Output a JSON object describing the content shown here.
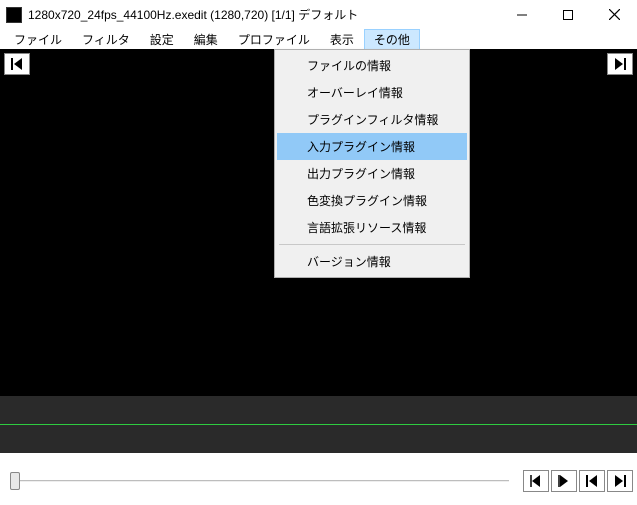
{
  "window": {
    "title": "1280x720_24fps_44100Hz.exedit (1280,720) [1/1] デフォルト"
  },
  "menubar": {
    "items": [
      {
        "label": "ファイル"
      },
      {
        "label": "フィルタ"
      },
      {
        "label": "設定"
      },
      {
        "label": "編集"
      },
      {
        "label": "プロファイル"
      },
      {
        "label": "表示"
      },
      {
        "label": "その他",
        "open": true
      }
    ]
  },
  "dropdown": {
    "items": [
      {
        "label": "ファイルの情報"
      },
      {
        "label": "オーバーレイ情報"
      },
      {
        "label": "プラグインフィルタ情報"
      },
      {
        "label": "入力プラグイン情報",
        "highlight": true
      },
      {
        "label": "出力プラグイン情報"
      },
      {
        "label": "色変換プラグイン情報"
      },
      {
        "label": "言語拡張リソース情報"
      }
    ],
    "footer": "バージョン情報"
  },
  "colors": {
    "highlight": "#91c9f7",
    "menu_open": "#cce8ff",
    "timeline_line": "#2ecc40"
  }
}
